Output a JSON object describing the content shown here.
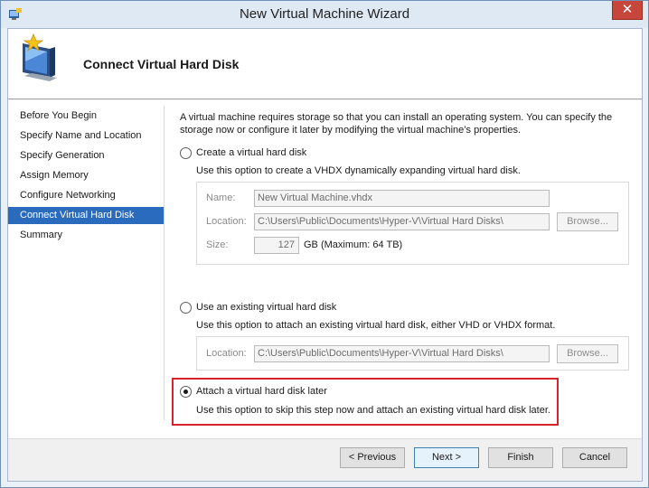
{
  "window": {
    "title": "New Virtual Machine Wizard",
    "close_glyph": "✕"
  },
  "header": {
    "page_title": "Connect Virtual Hard Disk",
    "icon": "wizard-monitor-star-icon"
  },
  "steps": [
    {
      "label": "Before You Begin",
      "active": false
    },
    {
      "label": "Specify Name and Location",
      "active": false
    },
    {
      "label": "Specify Generation",
      "active": false
    },
    {
      "label": "Assign Memory",
      "active": false
    },
    {
      "label": "Configure Networking",
      "active": false
    },
    {
      "label": "Connect Virtual Hard Disk",
      "active": true
    },
    {
      "label": "Summary",
      "active": false
    }
  ],
  "description": "A virtual machine requires storage so that you can install an operating system. You can specify the storage now or configure it later by modifying the virtual machine’s properties.",
  "options": {
    "create": {
      "label": "Create a virtual hard disk",
      "help": "Use this option to create a VHDX dynamically expanding virtual hard disk.",
      "selected": false,
      "name_label": "Name:",
      "name_value": "New Virtual Machine.vhdx",
      "location_label": "Location:",
      "location_value": "C:\\Users\\Public\\Documents\\Hyper-V\\Virtual Hard Disks\\",
      "browse_label": "Browse...",
      "size_label": "Size:",
      "size_value": "127",
      "size_unit": "GB (Maximum: 64 TB)"
    },
    "existing": {
      "label": "Use an existing virtual hard disk",
      "help": "Use this option to attach an existing virtual hard disk, either VHD or VHDX format.",
      "selected": false,
      "location_label": "Location:",
      "location_value": "C:\\Users\\Public\\Documents\\Hyper-V\\Virtual Hard Disks\\",
      "browse_label": "Browse..."
    },
    "later": {
      "label": "Attach a virtual hard disk later",
      "help": "Use this option to skip this step now and attach an existing virtual hard disk later.",
      "selected": true
    }
  },
  "highlight_color": "#d9232c",
  "buttons": {
    "previous": "< Previous",
    "next": "Next >",
    "finish": "Finish",
    "cancel": "Cancel"
  }
}
